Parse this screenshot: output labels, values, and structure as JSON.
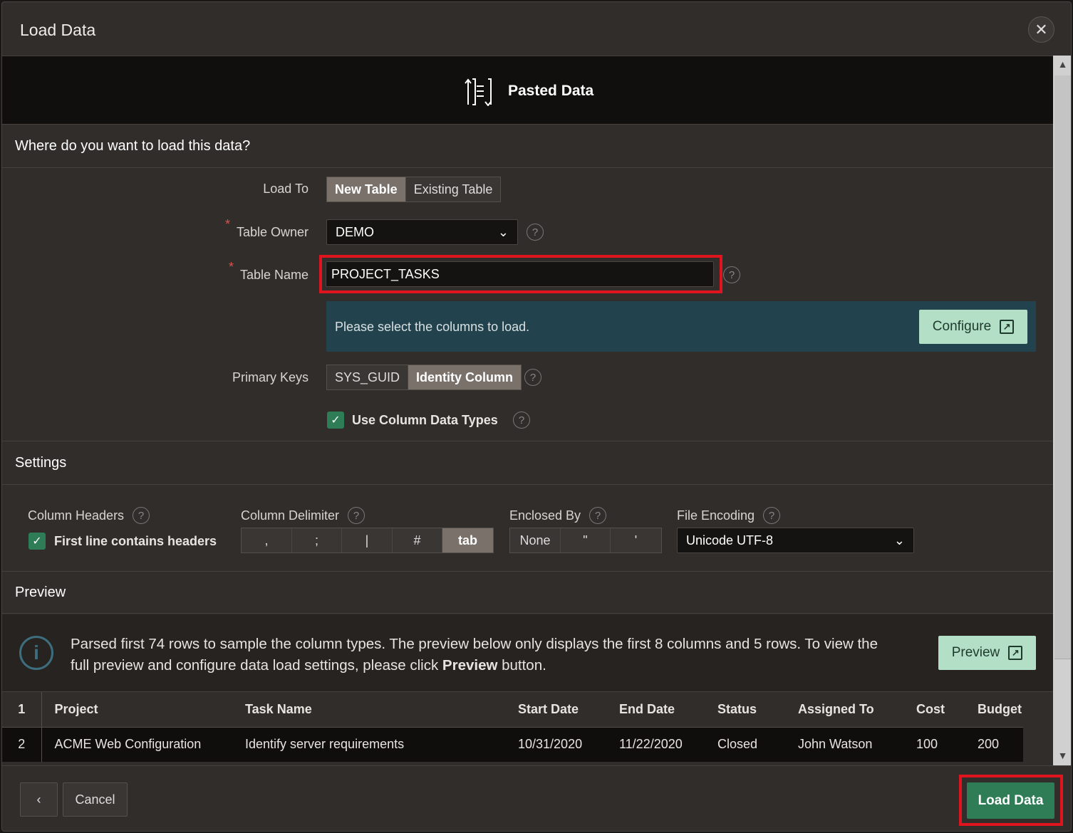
{
  "dialog": {
    "title": "Load Data",
    "close_icon": "close-icon"
  },
  "source": {
    "label": "Pasted Data",
    "icon": "pasted-data-icon"
  },
  "destination": {
    "heading": "Where do you want to load this data?",
    "load_to_label": "Load To",
    "load_to_options": [
      "New Table",
      "Existing Table"
    ],
    "load_to_selected": "New Table",
    "owner_label": "Table Owner",
    "owner_value": "DEMO",
    "table_name_label": "Table Name",
    "table_name_value": "PROJECT_TASKS",
    "columns_message": "Please select the columns to load.",
    "configure_label": "Configure",
    "pk_label": "Primary Keys",
    "pk_options": [
      "SYS_GUID",
      "Identity Column"
    ],
    "pk_selected": "Identity Column",
    "use_types_label": "Use Column Data Types",
    "use_types_checked": true
  },
  "settings": {
    "heading": "Settings",
    "headers_label": "Column Headers",
    "headers_check_label": "First line contains headers",
    "headers_checked": true,
    "delimiter_label": "Column Delimiter",
    "delimiters": [
      ",",
      ";",
      "|",
      "#",
      "tab"
    ],
    "delimiter_selected": "tab",
    "enclosed_label": "Enclosed By",
    "enclosed_options": [
      "None",
      "\"",
      "'"
    ],
    "encoding_label": "File Encoding",
    "encoding_value": "Unicode UTF-8"
  },
  "preview": {
    "heading": "Preview",
    "info_1": "Parsed first 74 rows to sample the column types. The preview below only displays the first 8 columns and 5 rows. To view the",
    "info_2a": "full preview and configure data load settings, please click ",
    "info_2b": "Preview",
    "info_2c": " button.",
    "button_label": "Preview",
    "columns": [
      "1",
      "Project",
      "Task Name",
      "Start Date",
      "End Date",
      "Status",
      "Assigned To",
      "Cost",
      "Budget"
    ],
    "rows": [
      [
        "2",
        "ACME Web Configuration",
        "Identify server requirements",
        "10/31/2020",
        "11/22/2020",
        "Closed",
        "John Watson",
        "100",
        "200"
      ]
    ]
  },
  "footer": {
    "back_icon": "chevron-left-icon",
    "cancel_label": "Cancel",
    "load_label": "Load Data"
  },
  "colors": {
    "accent_green": "#2f7d57",
    "mint": "#b4dfc7",
    "highlight_red": "#e0141e",
    "info_bg": "#22434e"
  }
}
